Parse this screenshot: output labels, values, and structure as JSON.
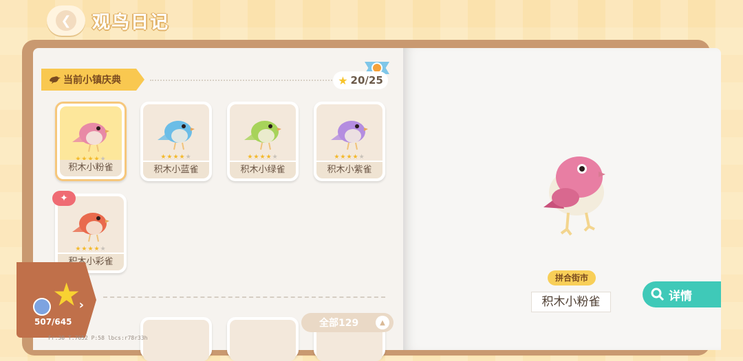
{
  "header": {
    "title": "观鸟日记"
  },
  "section": {
    "title": "当前小镇庆典",
    "star_count": "20/25"
  },
  "cards": [
    {
      "name": "积木小粉雀",
      "stars": 4,
      "selected": true,
      "color": "#e889a6"
    },
    {
      "name": "积木小蓝雀",
      "stars": 4,
      "selected": false,
      "color": "#6bbde7"
    },
    {
      "name": "积木小绿雀",
      "stars": 4,
      "selected": false,
      "color": "#a7d35a"
    },
    {
      "name": "积木小紫雀",
      "stars": 4,
      "selected": false,
      "color": "#b48de0"
    },
    {
      "name": "积木小彩雀",
      "stars": 4,
      "selected": false,
      "color": "#e96a4d",
      "new": true
    }
  ],
  "all_tab": {
    "label": "全部129"
  },
  "progress": {
    "count": "507/645"
  },
  "debug": "Fr:30  T:7652  P:58   lbcs:r78r33h",
  "detail": {
    "location": "拼合街市",
    "bird_name": "积木小粉雀",
    "button_label": "详情"
  },
  "icons": {
    "back": "back-arrow-icon",
    "star": "star-icon",
    "search": "search-icon"
  }
}
